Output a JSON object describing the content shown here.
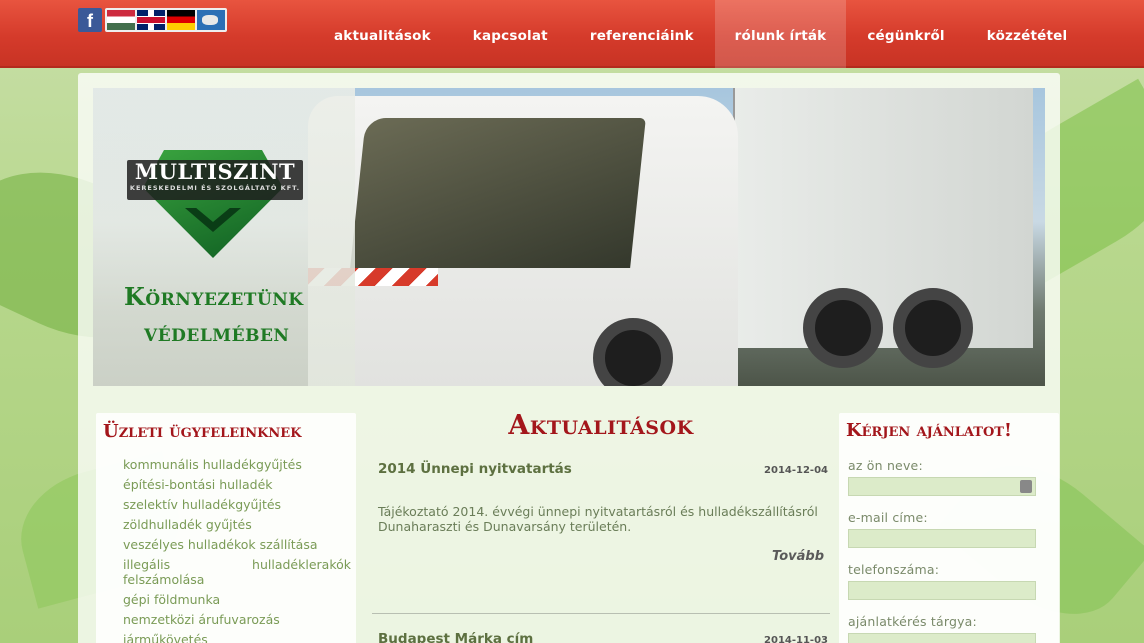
{
  "header": {
    "social": {
      "facebook_glyph": "f",
      "icon": "facebook-icon"
    },
    "languages": [
      {
        "icon": "flag-hungary-icon"
      },
      {
        "icon": "flag-uk-icon"
      },
      {
        "icon": "flag-germany-icon"
      },
      {
        "icon": "flag-world-icon"
      }
    ],
    "nav": [
      {
        "label": "aktualitások",
        "active": false
      },
      {
        "label": "kapcsolat",
        "active": false
      },
      {
        "label": "referenciáink",
        "active": false
      },
      {
        "label": "rólunk írták",
        "active": true
      },
      {
        "label": "cégünkről",
        "active": false
      },
      {
        "label": "közzététel",
        "active": false
      }
    ]
  },
  "banner": {
    "logo_name": "MULTISZINT",
    "logo_sub": "KERESKEDELMI ÉS SZOLGÁLTATÓ KFT.",
    "slogan_line1": "Környezetünk",
    "slogan_line2": "védelmében"
  },
  "sidebar": {
    "title": "Üzleti ügyfeleinknek",
    "items": [
      "kommunális hulladékgyűjtés",
      "építési-bontási hulladék",
      "szelektív hulladékgyűjtés",
      "zöldhulladék gyűjtés",
      "veszélyes hulladékok szállítása",
      "illegális hulladéklerakók felszámolása",
      "gépi földmunka",
      "nemzetközi árufuvarozás",
      "járműkövetés"
    ]
  },
  "main": {
    "title": "Aktualitások",
    "news": [
      {
        "title": "2014 Ünnepi nyitvatartás",
        "date": "2014-12-04",
        "body": "Tájékoztató 2014. évvégi ünnepi nyitvatartásról és hulladékszállításról Dunaharaszti és Dunavarsány területén.",
        "more": "Tovább"
      },
      {
        "title": "Budapest Márka cím",
        "date": "2014-11-03"
      }
    ]
  },
  "form": {
    "title": "Kérjen ajánlatot!",
    "name_label": "az ön neve:",
    "email_label": "e-mail címe:",
    "phone_label": "telefonszáma:",
    "subject_label": "ajánlatkérés tárgya:"
  },
  "colors": {
    "nav_red": "#d53b2b",
    "heading_red": "#a3161b",
    "link_green": "#7a9b56",
    "input_green": "#dcebc9"
  }
}
